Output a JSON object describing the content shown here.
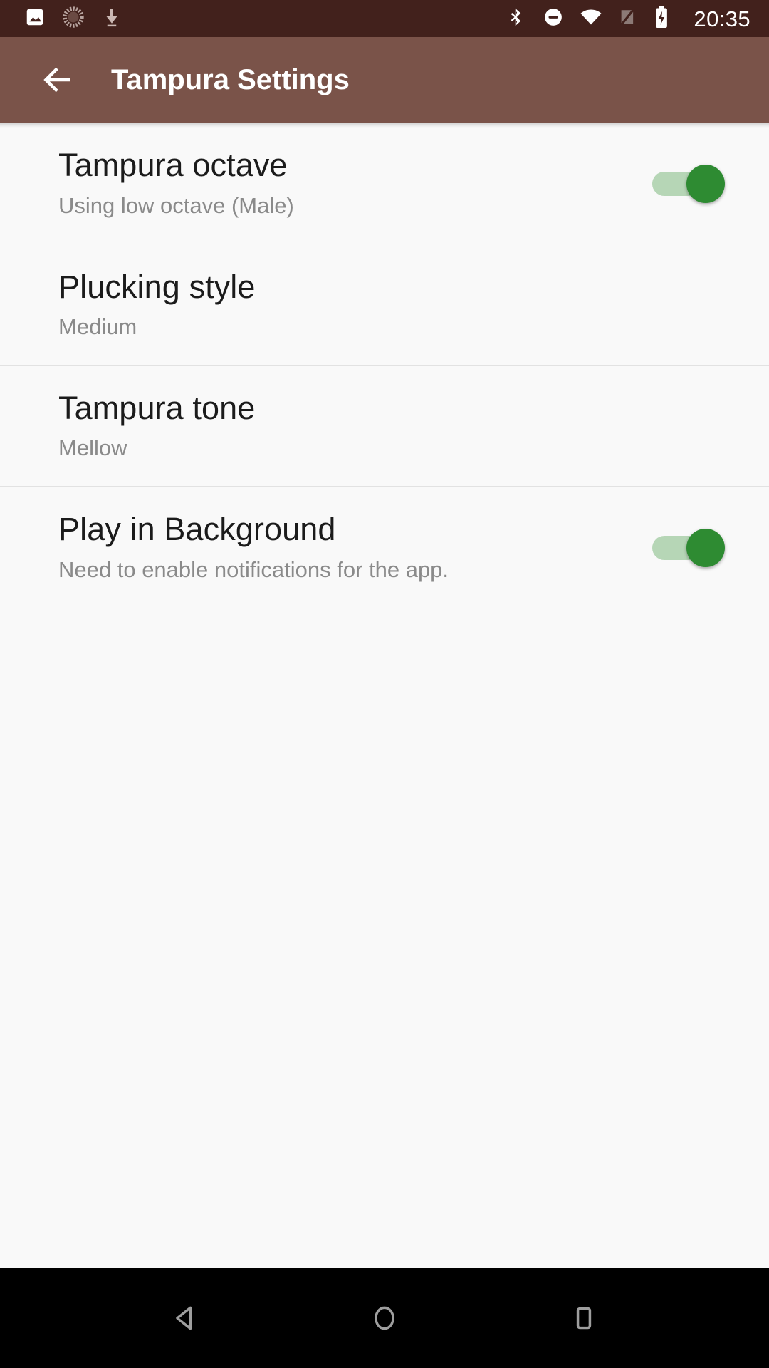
{
  "status_bar": {
    "background_color": "#42211c",
    "time": "20:35",
    "left_icons": [
      {
        "name": "photo-icon",
        "label": "Screenshot"
      },
      {
        "name": "sync-spinner-icon",
        "label": "Syncing"
      },
      {
        "name": "download-icon",
        "label": "Download"
      }
    ],
    "right_icons": [
      {
        "name": "bluetooth-icon",
        "label": "Bluetooth"
      },
      {
        "name": "do-not-disturb-icon",
        "label": "Do Not Disturb"
      },
      {
        "name": "wifi-icon",
        "label": "Wi-Fi"
      },
      {
        "name": "no-sim-icon",
        "label": "No SIM"
      },
      {
        "name": "battery-charging-icon",
        "label": "Battery charging"
      }
    ]
  },
  "app_bar": {
    "title": "Tampura Settings",
    "background_color": "#7a5349",
    "back_label": "Navigate up"
  },
  "settings": {
    "accent_on_color": "#2e8b32",
    "track_on_color": "#b6d6b6",
    "items": [
      {
        "title": "Tampura octave",
        "summary": "Using low octave (Male)",
        "control": "switch",
        "checked": true
      },
      {
        "title": "Plucking style",
        "summary": "Medium",
        "control": "none",
        "checked": false
      },
      {
        "title": "Tampura tone",
        "summary": "Mellow",
        "control": "none",
        "checked": false
      },
      {
        "title": "Play in Background",
        "summary": "Need to enable notifications for the app.",
        "control": "switch",
        "checked": true
      }
    ]
  },
  "nav_bar": {
    "background_color": "#000000",
    "buttons": [
      {
        "name": "nav-back-button",
        "label": "Back"
      },
      {
        "name": "nav-home-button",
        "label": "Home"
      },
      {
        "name": "nav-recents-button",
        "label": "Recents"
      }
    ]
  }
}
